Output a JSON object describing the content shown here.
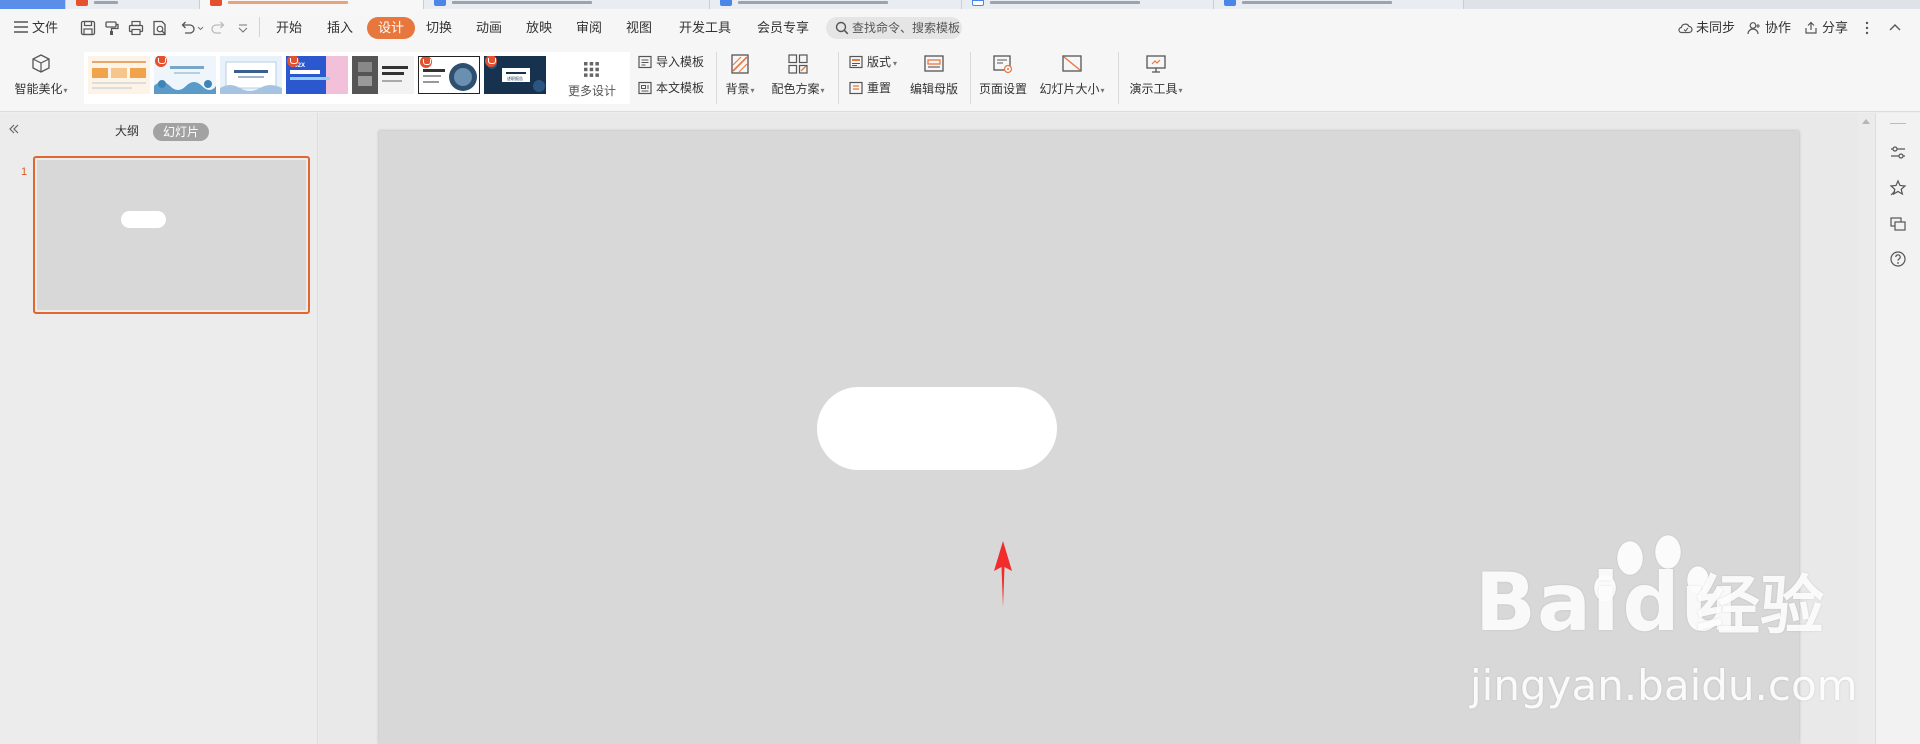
{
  "menu": {
    "file_label": "文件",
    "tabs": [
      "开始",
      "插入",
      "设计",
      "切换",
      "动画",
      "放映",
      "审阅",
      "视图",
      "开发工具",
      "会员专享"
    ],
    "active_tab": "设计",
    "search_placeholder": "查找命令、搜索模板",
    "sync_label": "未同步",
    "collab_label": "协作",
    "share_label": "分享"
  },
  "ribbon": {
    "smart_beautify": "智能美化",
    "more_design": "更多设计",
    "import_template": "导入模板",
    "text_template": "本文模板",
    "background": "背景",
    "color_scheme": "配色方案",
    "layout": "版式",
    "reset": "重置",
    "edit_master": "编辑母版",
    "page_setup": "页面设置",
    "slide_size": "幻灯片大小",
    "present_tools": "演示工具",
    "thumb_texts": [
      "202X",
      "述职报告"
    ]
  },
  "left_panel": {
    "tab_outline": "大纲",
    "tab_slides": "幻灯片",
    "slide_number": "1"
  },
  "watermark": {
    "brand": "Bai",
    "brand_du": "du",
    "cn": "经验",
    "url": "jingyan.baidu.com"
  },
  "colors": {
    "accent": "#e8773d",
    "slide_bg": "#d8d8d8",
    "arrow": "#f02c2c"
  }
}
